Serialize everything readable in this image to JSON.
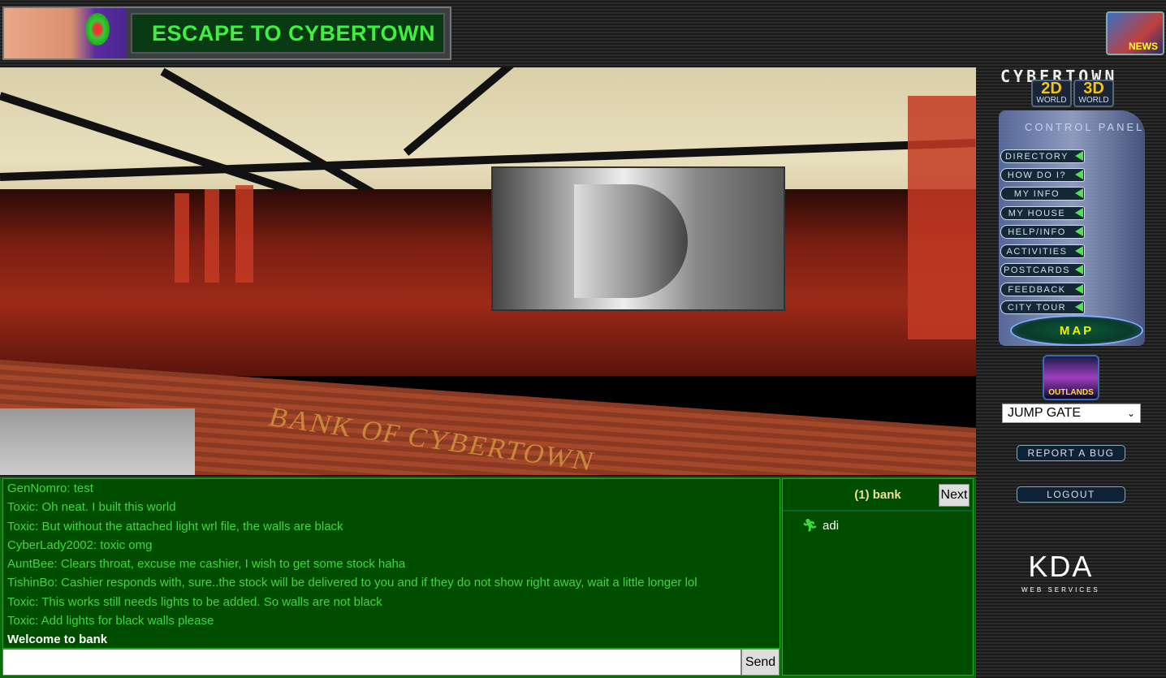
{
  "header": {
    "banner_title": "ESCAPE TO CYBERTOWN",
    "news_label": "NEWS"
  },
  "scene": {
    "sign_text": "BANK OF CYBERTOWN"
  },
  "chat": {
    "messages": [
      {
        "text": "GenNomro: test",
        "type": "user"
      },
      {
        "text": "Toxic: Oh neat. I built this world",
        "type": "user"
      },
      {
        "text": "Toxic: But without the attached light wrl file, the walls are black",
        "type": "user"
      },
      {
        "text": "CyberLady2002: toxic omg",
        "type": "user"
      },
      {
        "text": "AuntBee: Clears throat, excuse me cashier, I wish to get some stock haha",
        "type": "user"
      },
      {
        "text": "TishinBo: Cashier responds with, sure..the stock will be delivered to you and if they do not show right away, wait a little longer lol",
        "type": "user"
      },
      {
        "text": "Toxic: This works still needs lights to be added. So walls are not black",
        "type": "user"
      },
      {
        "text": "Toxic: Add lights for black walls please",
        "type": "user"
      },
      {
        "text": "Welcome to bank",
        "type": "system"
      }
    ],
    "input_value": "",
    "send_label": "Send"
  },
  "users": {
    "room_title": "(1) bank",
    "next_label": "Next",
    "list": [
      {
        "name": "adi",
        "icon": "running-avatar-icon"
      }
    ]
  },
  "sidebar": {
    "logo": "CYBERTOWN",
    "world_2d": {
      "big": "2D",
      "small": "WORLD"
    },
    "world_3d": {
      "big": "3D",
      "small": "WORLD"
    },
    "control_panel_title": "CONTROL PANEL",
    "nav": [
      "DIRECTORY",
      "HOW DO I?",
      "MY INFO",
      "MY HOUSE",
      "HELP/INFO",
      "ACTIVITIES",
      "POSTCARDS",
      "FEEDBACK",
      "CITY TOUR"
    ],
    "map_label": "MAP",
    "outlands_label": "OUTLANDS",
    "jump_gate_selected": "JUMP GATE",
    "report_bug_label": "REPORT A BUG",
    "logout_label": "LOGOUT",
    "kda_logo": "KDA",
    "kda_sub": "WEB SERVICES"
  },
  "colors": {
    "chat_text": "#3ed83e",
    "chat_bg": "#004d00",
    "banner_text": "#3cf23c",
    "room_title": "#f3e08a"
  }
}
